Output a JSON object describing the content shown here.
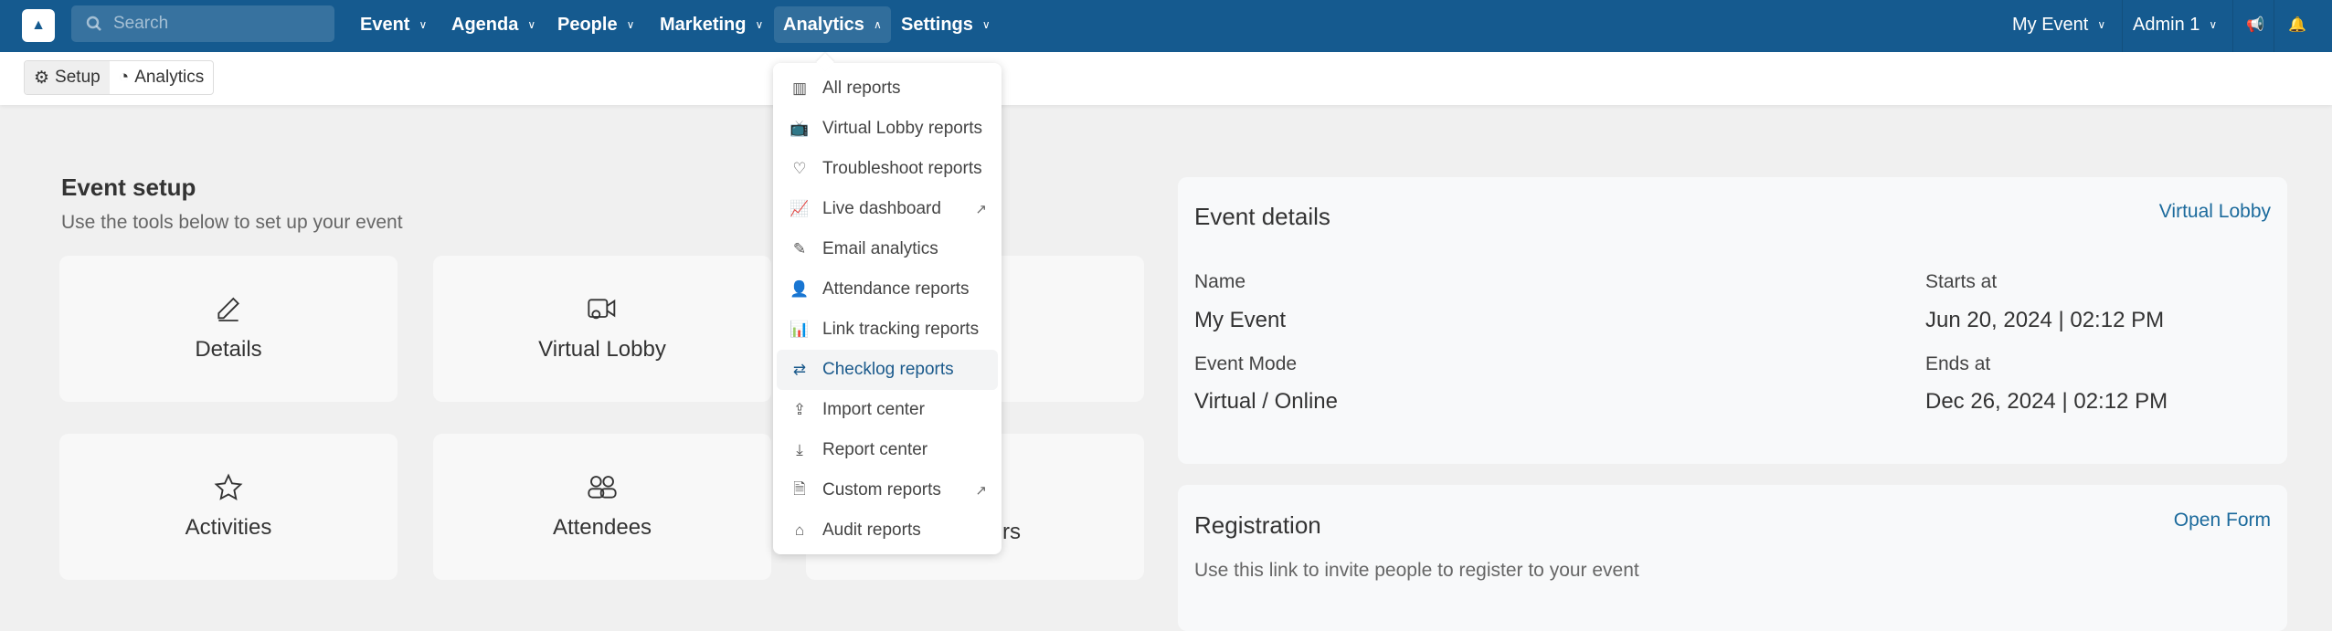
{
  "nav": {
    "search_placeholder": "Search",
    "items": [
      {
        "label": "Event"
      },
      {
        "label": "Agenda"
      },
      {
        "label": "People"
      },
      {
        "label": "Marketing"
      },
      {
        "label": "Analytics",
        "active": true
      },
      {
        "label": "Settings"
      }
    ],
    "event_selector": "My Event",
    "user": "Admin 1",
    "accent": "#155a8f"
  },
  "subnav": {
    "setup": "Setup",
    "analytics": "Analytics"
  },
  "setup": {
    "title": "Event setup",
    "subtitle": "Use the tools below to set up your event",
    "cards": [
      {
        "label": "Details",
        "icon": "pencil-icon"
      },
      {
        "label": "Virtual Lobby",
        "icon": "video-camera-icon"
      },
      {
        "label": ""
      },
      {
        "label": "Activities",
        "icon": "star-icon"
      },
      {
        "label": "Attendees",
        "icon": "users-icon"
      },
      {
        "label": "rs"
      }
    ]
  },
  "event_details": {
    "title": "Event details",
    "link": "Virtual Lobby",
    "name_label": "Name",
    "name": "My Event",
    "mode_label": "Event Mode",
    "mode": "Virtual / Online",
    "start_label": "Starts at",
    "start": "Jun 20, 2024 | 02:12 PM",
    "end_label": "Ends at",
    "end": "Dec 26, 2024 | 02:12 PM"
  },
  "registration": {
    "title": "Registration",
    "link": "Open Form",
    "text": "Use this link to invite people to register to your event"
  },
  "analytics_menu": [
    {
      "label": "All reports",
      "icon": "bar-chart-icon"
    },
    {
      "label": "Virtual Lobby reports",
      "icon": "tv-icon"
    },
    {
      "label": "Troubleshoot reports",
      "icon": "heartbeat-icon"
    },
    {
      "label": "Live dashboard",
      "icon": "line-chart-icon",
      "external": true
    },
    {
      "label": "Email analytics",
      "icon": "edit-icon"
    },
    {
      "label": "Attendance reports",
      "icon": "user-clock-icon"
    },
    {
      "label": "Link tracking reports",
      "icon": "chart-trend-icon"
    },
    {
      "label": "Checklog reports",
      "icon": "arrows-exchange-icon",
      "selected": true
    },
    {
      "label": "Import center",
      "icon": "upload-tray-icon"
    },
    {
      "label": "Report center",
      "icon": "download-tray-icon"
    },
    {
      "label": "Custom reports",
      "icon": "file-chart-icon",
      "external": true
    },
    {
      "label": "Audit reports",
      "icon": "warehouse-icon"
    }
  ]
}
